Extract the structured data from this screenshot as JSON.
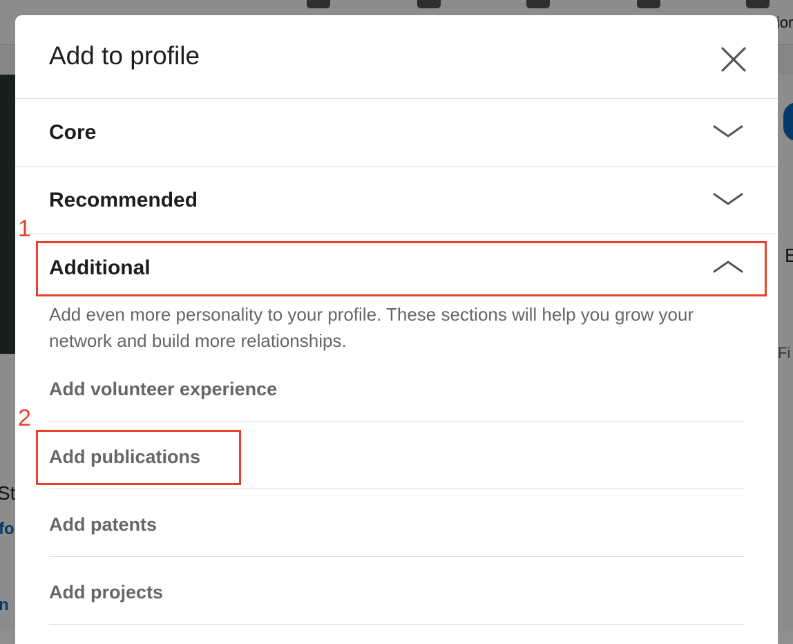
{
  "modal": {
    "title": "Add to profile",
    "close_icon": "close-icon"
  },
  "sections": [
    {
      "label": "Core",
      "state": "collapsed",
      "icon": "chevron-down-icon"
    },
    {
      "label": "Recommended",
      "state": "collapsed",
      "icon": "chevron-down-icon"
    },
    {
      "label": "Additional",
      "state": "expanded",
      "icon": "chevron-up-icon"
    }
  ],
  "additional": {
    "description": "Add even more personality to your profile. These sections will help you grow your network and build more relationships.",
    "items": [
      {
        "label": "Add volunteer experience"
      },
      {
        "label": "Add publications"
      },
      {
        "label": "Add patents"
      },
      {
        "label": "Add projects"
      }
    ]
  },
  "annotations": [
    {
      "number": "1",
      "target": "Additional",
      "color": "#e8432a"
    },
    {
      "number": "2",
      "target": "Add publications",
      "color": "#e8432a"
    }
  ],
  "background": {
    "fragments": [
      "ior",
      "E",
      "Fi",
      "St",
      "fo",
      "n"
    ]
  },
  "colors": {
    "title_text": "#1d1d1d",
    "item_text": "#666666",
    "annotation": "#e8432a"
  }
}
